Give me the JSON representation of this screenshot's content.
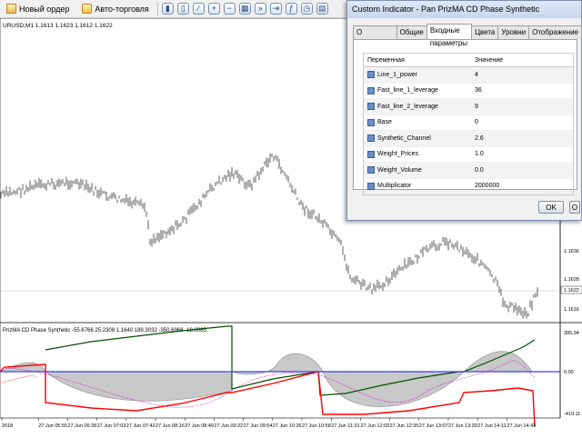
{
  "toolbar": {
    "new_order": "Новый ордер",
    "auto_trading": "Авто-торговля"
  },
  "chart": {
    "symbol_label": "URUSD,M1  1.1613 1.1623 1.1612 1.1622",
    "price_labels": [
      "1.1636",
      "1.1628",
      "1.1622",
      "1.1616"
    ],
    "indicator_label": "PrizMA CD Phase Synthetic -55.6766 25.2308 1.1640 189.3032 -350.6968 -18.6065",
    "indicator_scale": [
      "395.94",
      "0.00",
      "-419.11"
    ],
    "time_labels": [
      "2018",
      "27 Jun 05:55",
      "27 Jun 06:28",
      "27 Jun 07:03",
      "27 Jun 07:42",
      "27 Jun 08:16",
      "27 Jun 08:49",
      "27 Jun 09:22",
      "27 Jun 09:54",
      "27 Jun 10:26",
      "27 Jun 10:58",
      "27 Jun 11:31",
      "27 Jun 12:03",
      "27 Jun 12:35",
      "27 Jun 13:07",
      "27 Jun 13:39",
      "27 Jun 14:11",
      "27 Jun 14:43"
    ]
  },
  "dialog": {
    "title": "Custom Indicator - Pan PrizMA CD Phase Synthetic",
    "tabs": [
      "О программе",
      "Общие",
      "Входные параметры",
      "Цвета",
      "Уровни",
      "Отображение"
    ],
    "active_tab": 2,
    "col_variable": "Переменная",
    "col_value": "Значение",
    "params": [
      {
        "name": "Line_1_power",
        "value": "4"
      },
      {
        "name": "Fast_line_1_leverage",
        "value": "36"
      },
      {
        "name": "Fast_line_2_leverage",
        "value": "9"
      },
      {
        "name": "Base",
        "value": "0"
      },
      {
        "name": "Synthetic_Channel",
        "value": "2.6"
      },
      {
        "name": "Weight_Prices",
        "value": "1.0"
      },
      {
        "name": "Weight_Volume",
        "value": "0.0"
      },
      {
        "name": "Multiplicator",
        "value": "2000000"
      }
    ],
    "ok": "OK",
    "cancel": "O"
  }
}
